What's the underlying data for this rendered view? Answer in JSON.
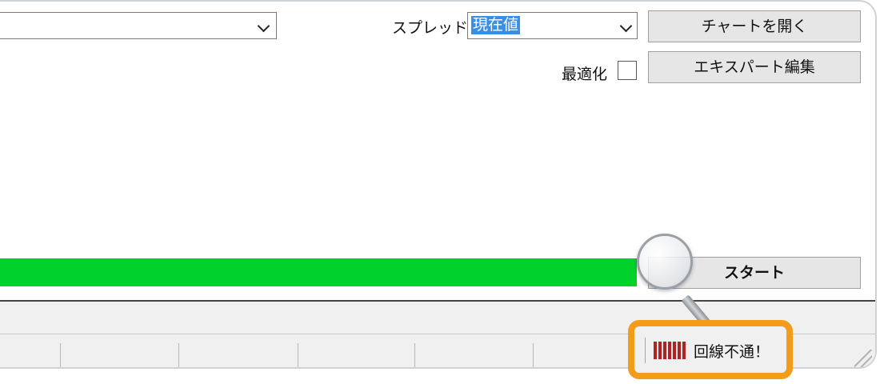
{
  "settings": {
    "symbol_select_value": "",
    "spread_label": "スプレッド:",
    "spread_value": "現在値",
    "optimize_label": "最適化",
    "optimize_checked": false
  },
  "buttons": {
    "open_chart": "チャートを開く",
    "edit_expert": "エキスパート編集",
    "start": "スタート"
  },
  "progress": {
    "percent": 100,
    "color": "#00d12b"
  },
  "status_bar": {
    "connection_status": "回線不通！",
    "connection_icon": "signal-bars-icon",
    "highlight_color": "#f39c1a",
    "signal_color": "#b22222"
  }
}
